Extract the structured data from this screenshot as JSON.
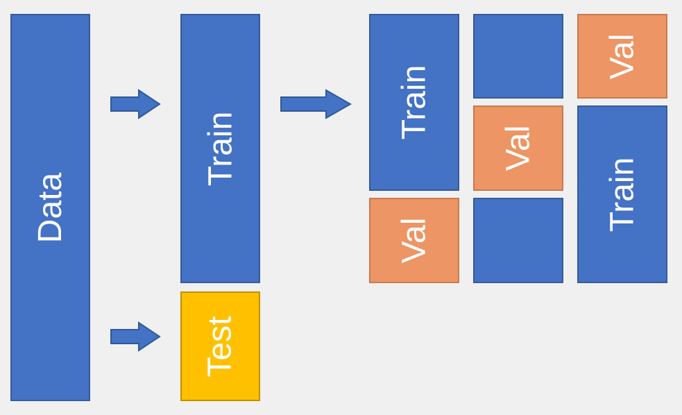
{
  "labels": {
    "data": "Data",
    "train": "Train",
    "test": "Test",
    "val": "Val"
  },
  "colors": {
    "blue": "#4472c4",
    "yellow": "#ffc000",
    "orange": "#ed9564",
    "arrow_fill": "#4472c4",
    "arrow_border": "#2e5a99"
  }
}
